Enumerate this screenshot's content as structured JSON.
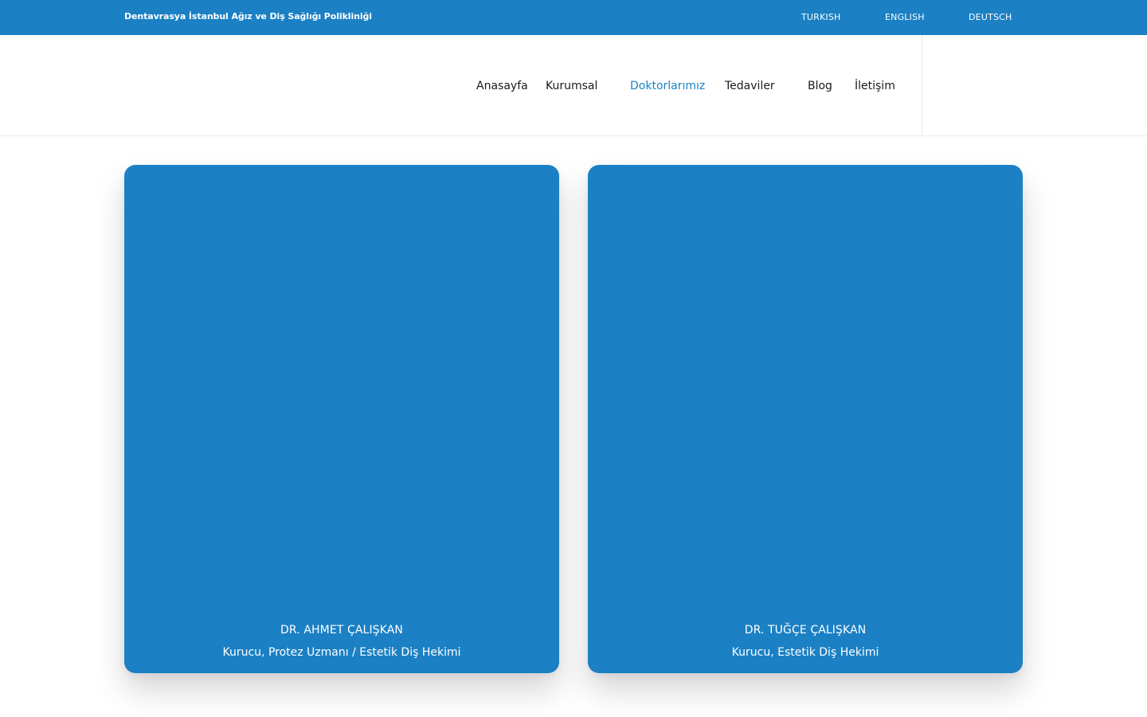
{
  "topbar": {
    "brand": "Dentavrasya İstanbul Ağız ve Diş Sağlığı Polikliniği",
    "languages": [
      "TURKISH",
      "ENGLISH",
      "DEUTSCH"
    ],
    "background_color": "#1b80c4"
  },
  "nav": {
    "items": [
      "Anasayfa",
      "Kurumsal",
      "Doktorlarımız",
      "Tedaviler",
      "Blog",
      "İletişim"
    ],
    "active": "Doktorlarımız",
    "active_color": "#1b80c4"
  },
  "doctors": [
    {
      "name": "DR. AHMET ÇALIŞKAN",
      "title": "Kurucu, Protez Uzmanı / Estetik Diş Hekimi"
    },
    {
      "name": "DR. TUĞÇE ÇALIŞKAN",
      "title": "Kurucu, Estetik Diş Hekimi"
    }
  ],
  "card_color": "#1b80c4"
}
